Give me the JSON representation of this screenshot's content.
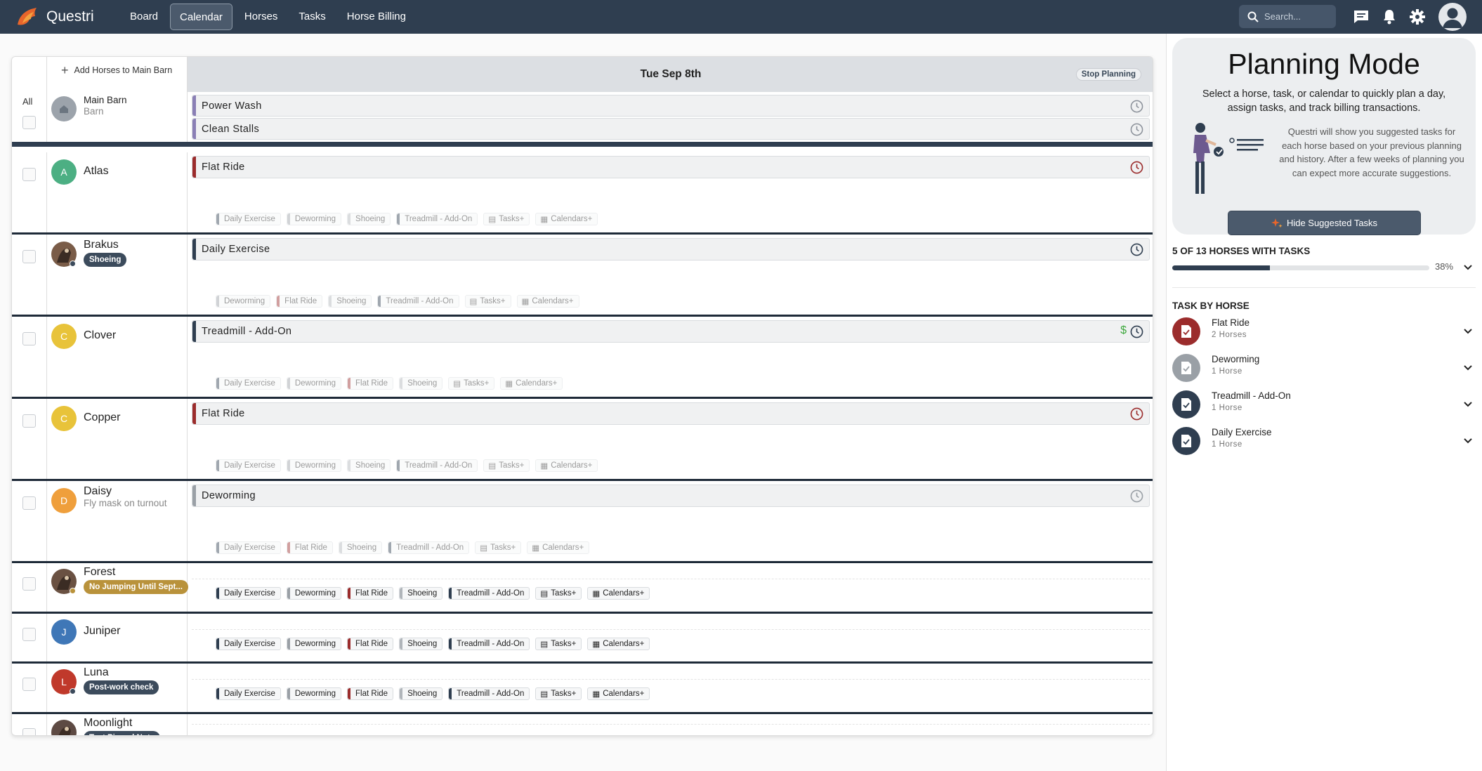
{
  "app": {
    "name": "Questri"
  },
  "nav": {
    "items": [
      {
        "label": "Board",
        "active": false
      },
      {
        "label": "Calendar",
        "active": true
      },
      {
        "label": "Horses",
        "active": false
      },
      {
        "label": "Tasks",
        "active": false
      },
      {
        "label": "Horse Billing",
        "active": false
      }
    ]
  },
  "search": {
    "placeholder": "Search..."
  },
  "calendar": {
    "add_horses_label": "Add Horses to Main Barn",
    "date_label": "Tue Sep 8th",
    "stop_planning_label": "Stop Planning",
    "all_label": "All",
    "barn": {
      "name": "Main Barn",
      "sub": "Barn",
      "tasks": [
        {
          "label": "Power Wash",
          "color": "#8a7fb5"
        },
        {
          "label": "Clean Stalls",
          "color": "#8a7fb5"
        }
      ]
    },
    "chip_tail": {
      "tasks": "Tasks",
      "calendars": "Calendars"
    },
    "horses": [
      {
        "name": "Atlas",
        "initial": "A",
        "avatar_color": "#4caf83",
        "task": {
          "label": "Flat Ride",
          "color": "#9b2c2c",
          "clock_color": "#9b2c2c"
        },
        "chips": [
          {
            "label": "Daily Exercise",
            "color": "#2f3e50"
          },
          {
            "label": "Deworming",
            "color": "#9aa0a6"
          },
          {
            "label": "Shoeing",
            "color": "#b0b5ba"
          },
          {
            "label": "Treadmill - Add-On",
            "color": "#2f3e50"
          }
        ]
      },
      {
        "name": "Brakus",
        "initial": "",
        "avatar_color": "#7a5c48",
        "badge": "Shoeing",
        "badge_color": "#3c4b5c",
        "task": {
          "label": "Daily Exercise",
          "color": "#2f3e50",
          "clock_color": "#2f3e50"
        },
        "chips": [
          {
            "label": "Deworming",
            "color": "#9aa0a6"
          },
          {
            "label": "Flat Ride",
            "color": "#9b2c2c"
          },
          {
            "label": "Shoeing",
            "color": "#b0b5ba"
          },
          {
            "label": "Treadmill - Add-On",
            "color": "#2f3e50"
          }
        ]
      },
      {
        "name": "Clover",
        "initial": "C",
        "avatar_color": "#e8c33a",
        "task": {
          "label": "Treadmill - Add-On",
          "color": "#2f3e50",
          "clock_color": "#2f3e50",
          "billing": "$"
        },
        "chips": [
          {
            "label": "Daily Exercise",
            "color": "#2f3e50"
          },
          {
            "label": "Deworming",
            "color": "#9aa0a6"
          },
          {
            "label": "Flat Ride",
            "color": "#9b2c2c"
          },
          {
            "label": "Shoeing",
            "color": "#b0b5ba"
          }
        ]
      },
      {
        "name": "Copper",
        "initial": "C",
        "avatar_color": "#e8c33a",
        "task": {
          "label": "Flat Ride",
          "color": "#9b2c2c",
          "clock_color": "#9b2c2c"
        },
        "chips": [
          {
            "label": "Daily Exercise",
            "color": "#2f3e50"
          },
          {
            "label": "Deworming",
            "color": "#9aa0a6"
          },
          {
            "label": "Shoeing",
            "color": "#b0b5ba"
          },
          {
            "label": "Treadmill - Add-On",
            "color": "#2f3e50"
          }
        ]
      },
      {
        "name": "Daisy",
        "initial": "D",
        "avatar_color": "#ef9f3c",
        "sub": "Fly mask on turnout",
        "task": {
          "label": "Deworming",
          "color": "#9aa0a6",
          "clock_color": "#9aa0a6"
        },
        "chips": [
          {
            "label": "Daily Exercise",
            "color": "#2f3e50"
          },
          {
            "label": "Flat Ride",
            "color": "#9b2c2c"
          },
          {
            "label": "Shoeing",
            "color": "#b0b5ba"
          },
          {
            "label": "Treadmill - Add-On",
            "color": "#2f3e50"
          }
        ]
      },
      {
        "name": "Forest",
        "initial": "",
        "avatar_color": "#6a5142",
        "badge": "No Jumping Until Sept...",
        "badge_color": "#b9923b",
        "chips": [
          {
            "label": "Daily Exercise",
            "color": "#2f3e50"
          },
          {
            "label": "Deworming",
            "color": "#9aa0a6"
          },
          {
            "label": "Flat Ride",
            "color": "#9b2c2c"
          },
          {
            "label": "Shoeing",
            "color": "#b0b5ba"
          },
          {
            "label": "Treadmill - Add-On",
            "color": "#2f3e50"
          }
        ]
      },
      {
        "name": "Juniper",
        "initial": "J",
        "avatar_color": "#3f77b7",
        "chips": [
          {
            "label": "Daily Exercise",
            "color": "#2f3e50"
          },
          {
            "label": "Deworming",
            "color": "#9aa0a6"
          },
          {
            "label": "Flat Ride",
            "color": "#9b2c2c"
          },
          {
            "label": "Shoeing",
            "color": "#b0b5ba"
          },
          {
            "label": "Treadmill - Add-On",
            "color": "#2f3e50"
          }
        ]
      },
      {
        "name": "Luna",
        "initial": "L",
        "avatar_color": "#c0392b",
        "badge": "Post-work check",
        "badge_color": "#3c4b5c",
        "chips": [
          {
            "label": "Daily Exercise",
            "color": "#2f3e50"
          },
          {
            "label": "Deworming",
            "color": "#9aa0a6"
          },
          {
            "label": "Flat Ride",
            "color": "#9b2c2c"
          },
          {
            "label": "Shoeing",
            "color": "#b0b5ba"
          },
          {
            "label": "Treadmill - Add-On",
            "color": "#2f3e50"
          }
        ]
      },
      {
        "name": "Moonlight",
        "initial": "",
        "avatar_color": "#5d4a43",
        "badge": "Test Pinned Note",
        "badge_color": "#3c4b5c",
        "chips": []
      }
    ]
  },
  "planning": {
    "title": "Planning Mode",
    "description": "Select a horse, task, or calendar to quickly plan a day, assign tasks, and track billing transactions.",
    "suggestion_text": "Questri will show you suggested tasks for each horse based on your previous planning and history. After a few weeks of planning you can expect more accurate suggestions.",
    "hide_button": "Hide Suggested Tasks",
    "progress_label": "5 OF 13 HORSES WITH TASKS",
    "progress_percent": 38,
    "progress_text": "38%",
    "task_by_horse_title": "TASK BY HORSE",
    "tasks": [
      {
        "name": "Flat Ride",
        "count": "2 Horses",
        "color": "#9b2c2c"
      },
      {
        "name": "Deworming",
        "count": "1 Horse",
        "color": "#9aa0a6"
      },
      {
        "name": "Treadmill - Add-On",
        "count": "1 Horse",
        "color": "#2f3e50"
      },
      {
        "name": "Daily Exercise",
        "count": "1 Horse",
        "color": "#2f3e50"
      }
    ]
  }
}
